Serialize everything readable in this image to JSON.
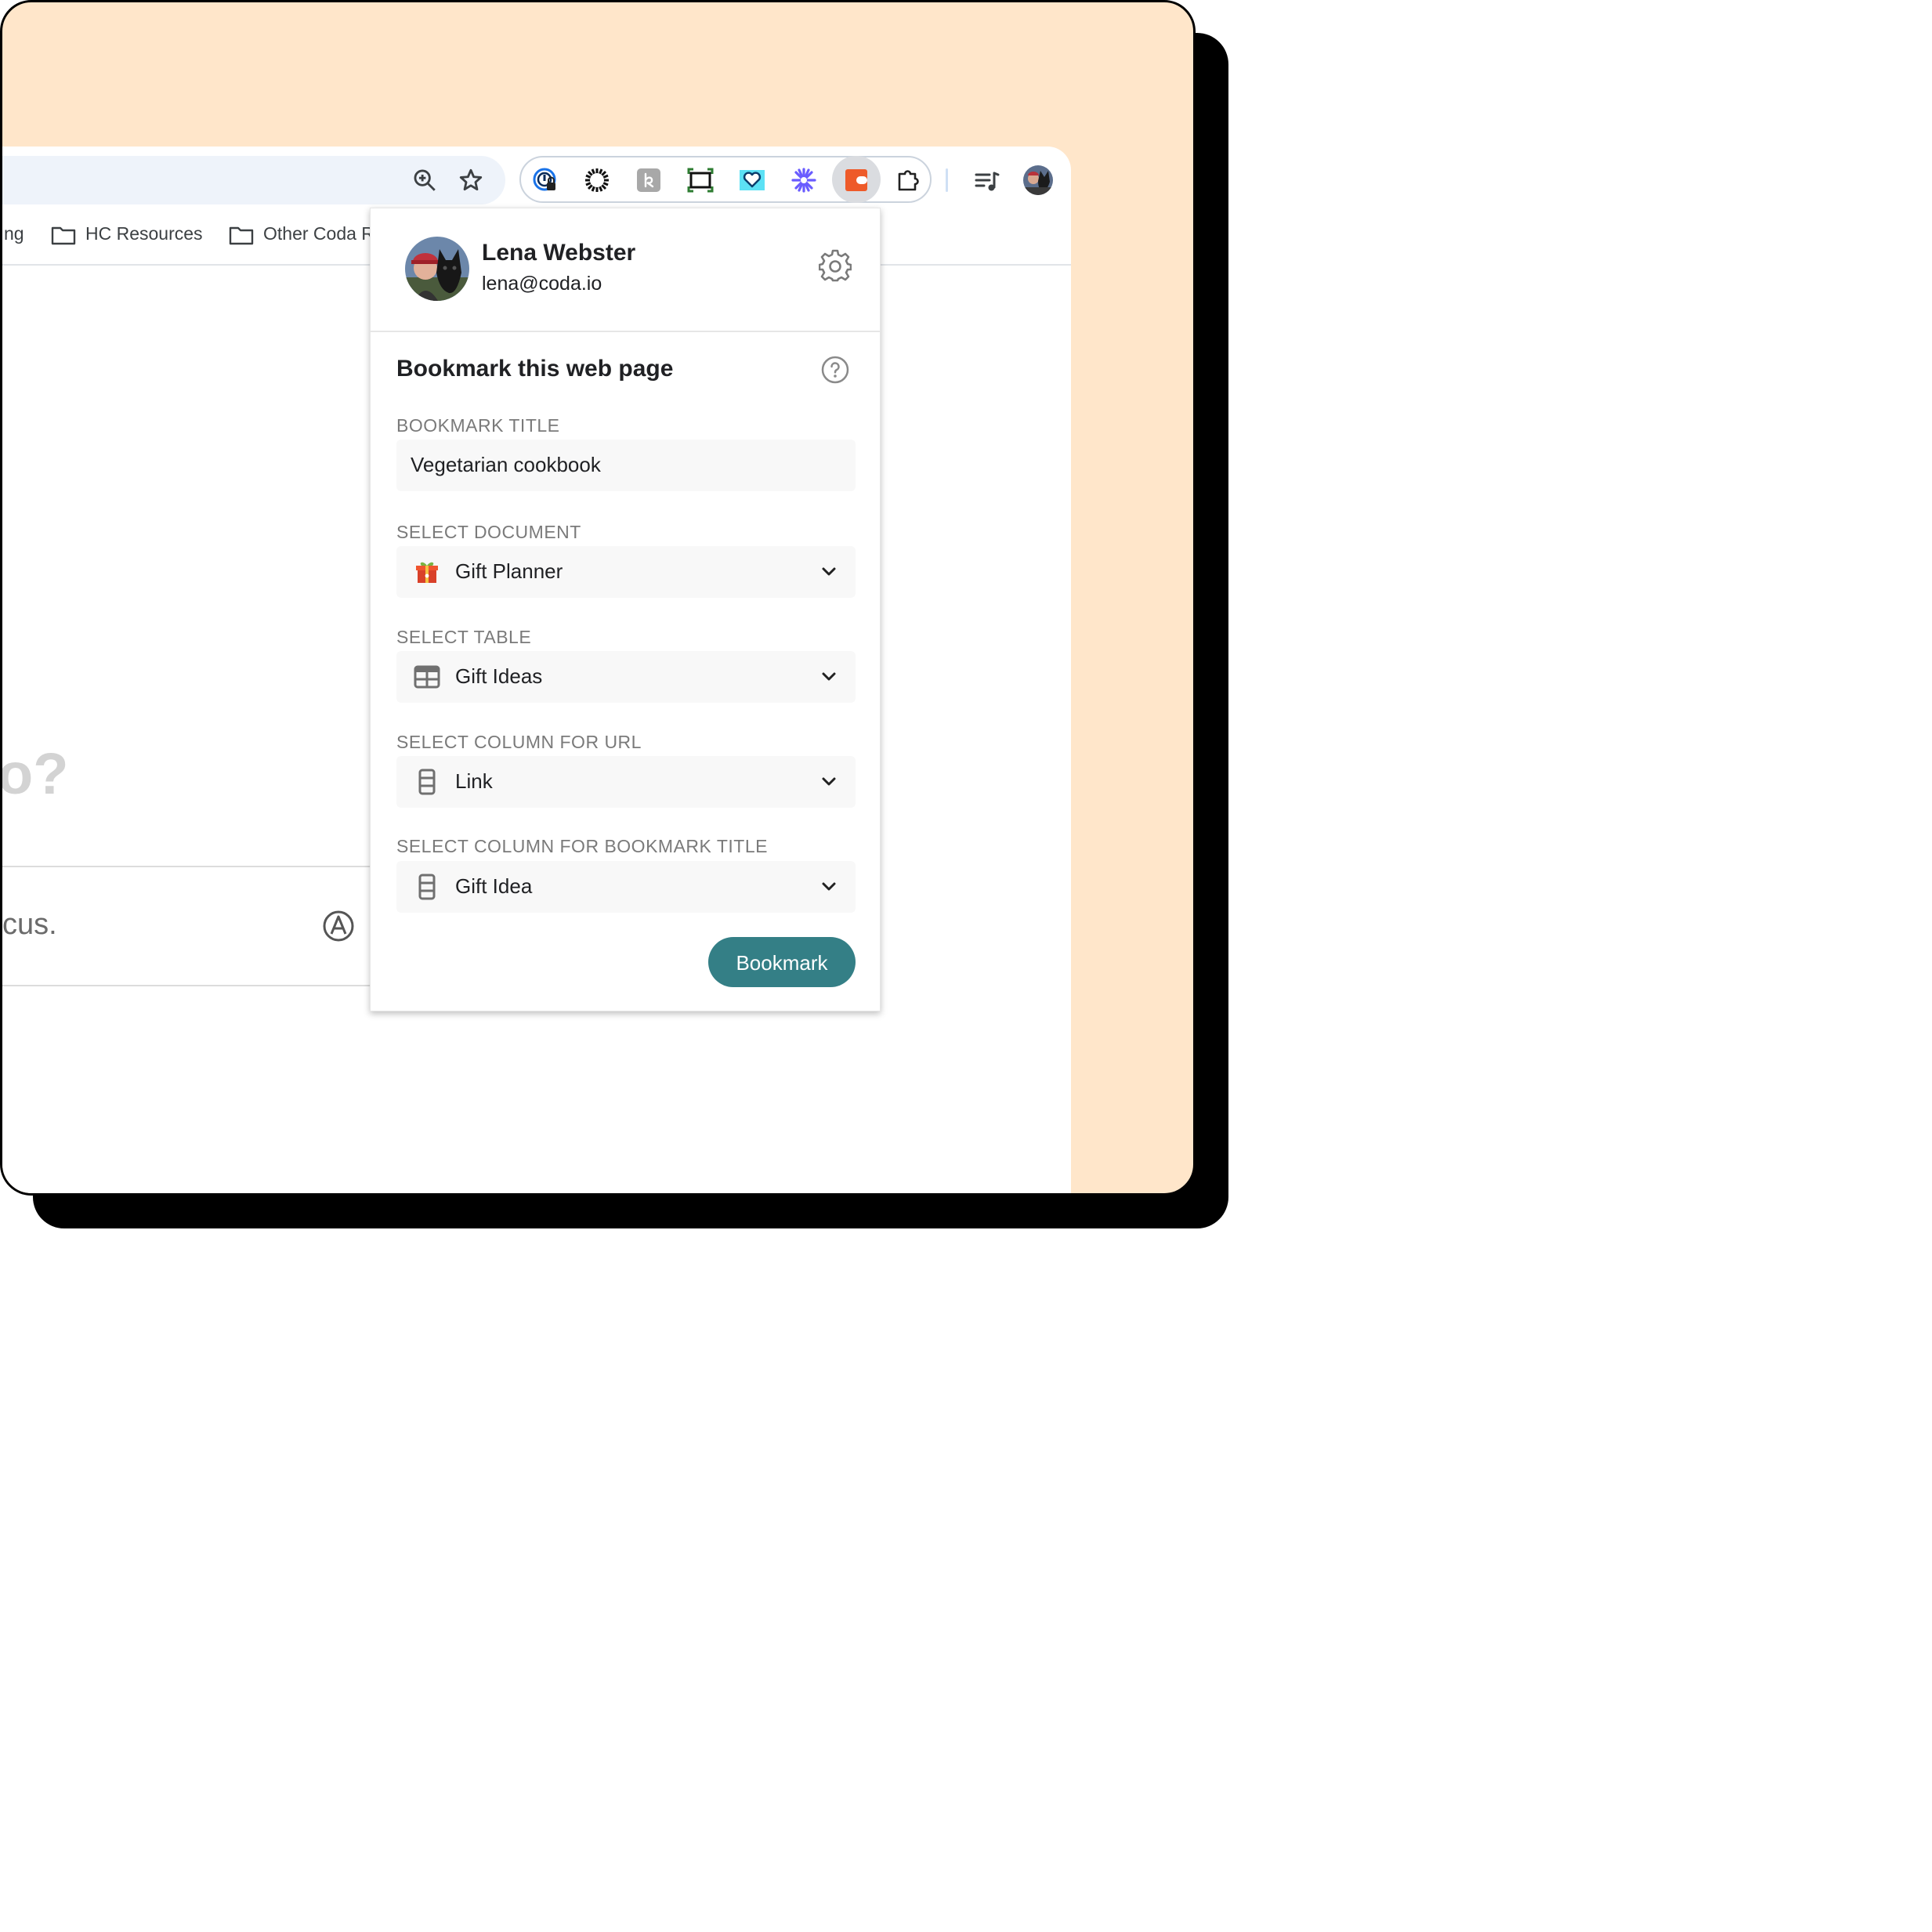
{
  "bookmarks_bar": {
    "items": [
      "ng",
      "HC Resources",
      "Other Coda R"
    ]
  },
  "background_page": {
    "heading_fragment": "o?",
    "input_fragment": "cus."
  },
  "popup": {
    "user": {
      "name": "Lena Webster",
      "email": "lena@coda.io"
    },
    "section_title": "Bookmark this web page",
    "fields": {
      "title_label": "BOOKMARK TITLE",
      "title_value": "Vegetarian cookbook",
      "document_label": "SELECT DOCUMENT",
      "document_value": "Gift Planner",
      "table_label": "SELECT TABLE",
      "table_value": "Gift Ideas",
      "url_column_label": "SELECT COLUMN FOR URL",
      "url_column_value": "Link",
      "title_column_label": "SELECT COLUMN FOR BOOKMARK TITLE",
      "title_column_value": "Gift Idea"
    },
    "submit_label": "Bookmark"
  },
  "colors": {
    "backdrop": "#FFE6CA",
    "button": "#347F86",
    "coda_brand": "#EE5A29"
  },
  "icons": [
    "zoom-icon",
    "star-icon",
    "password-manager-icon",
    "sun-extension-icon",
    "honey-extension-icon",
    "screenshot-extension-icon",
    "heart-extension-icon",
    "asterisk-extension-icon",
    "coda-extension-icon",
    "puzzle-icon",
    "media-icon",
    "profile-avatar",
    "folder-icon",
    "gear-icon",
    "help-icon",
    "gift-icon",
    "table-icon",
    "column-icon",
    "chevron-down-icon"
  ]
}
